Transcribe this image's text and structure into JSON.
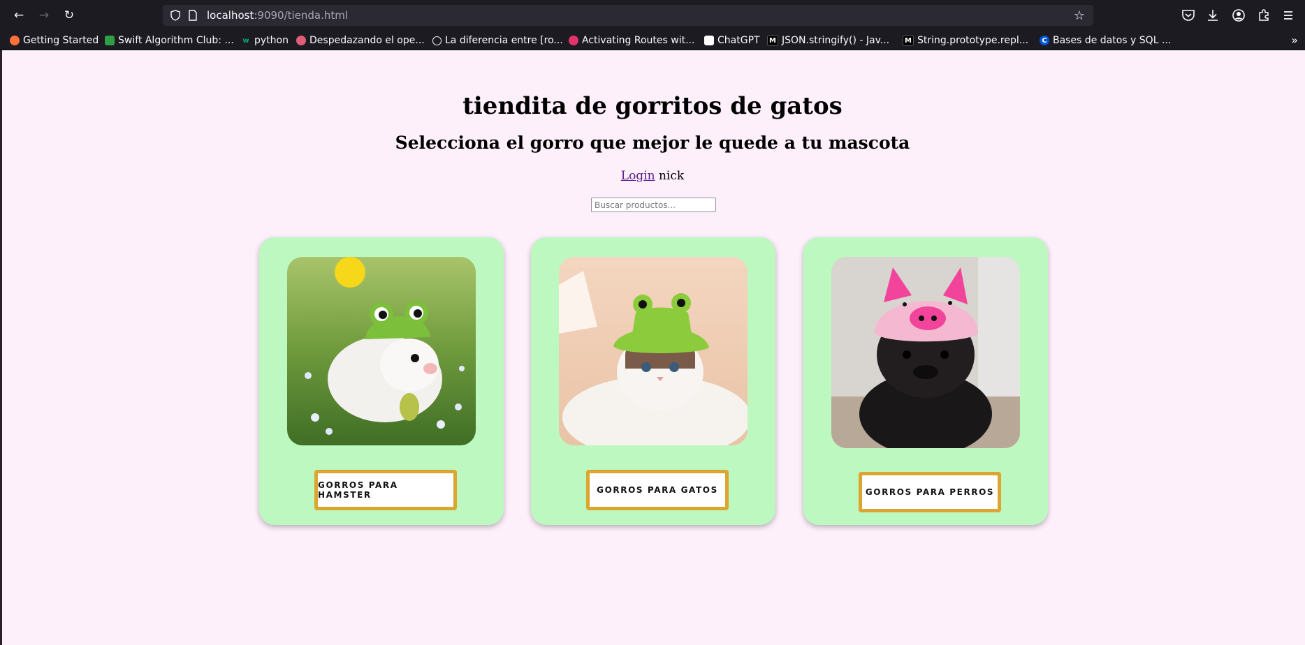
{
  "browser": {
    "url_host": "localhost",
    "url_path": ":9090/tienda.html",
    "bookmarks": [
      {
        "label": "Getting Started",
        "icon": "firefox-icon",
        "color": "#ff7139"
      },
      {
        "label": "Swift Algorithm Club: ...",
        "icon": "github-icon",
        "color": "#2ea043"
      },
      {
        "label": "python",
        "icon": "w3-icon",
        "color": "#04aa6d"
      },
      {
        "label": "Despedazando el ope...",
        "icon": "medium-icon",
        "color": "#e05d7a"
      },
      {
        "label": "La diferencia entre [ro...",
        "icon": "globe-icon",
        "color": "#fbfbfe"
      },
      {
        "label": "Activating Routes wit...",
        "icon": "video-icon",
        "color": "#e2336b"
      },
      {
        "label": "ChatGPT",
        "icon": "chatgpt-icon",
        "color": "#ffffff"
      },
      {
        "label": "JSON.stringify() - Jav...",
        "icon": "mdn-icon",
        "color": "#000000"
      },
      {
        "label": "String.prototype.repl...",
        "icon": "mdn-icon",
        "color": "#000000"
      },
      {
        "label": "Bases de datos y SQL ...",
        "icon": "coursera-icon",
        "color": "#0056d2"
      }
    ]
  },
  "page": {
    "title": "tiendita de gorritos de gatos",
    "subtitle": "Selecciona el gorro que mejor le quede a tu mascota",
    "login_link": "Login",
    "username": "nick",
    "search_placeholder": "Buscar productos...",
    "cards": [
      {
        "button": "GORROS PARA HAMSTER",
        "image": "hamster-frog-hat-photo"
      },
      {
        "button": "GORROS PARA GATOS",
        "image": "cat-frog-hat-photo"
      },
      {
        "button": "GORROS PARA PERROS",
        "image": "pug-pig-hat-photo"
      }
    ]
  },
  "colors": {
    "page_bg": "#fdf0fb",
    "card_bg": "#bdf8c0",
    "button_border": "#dba530",
    "chrome_bg": "#1c1b22"
  }
}
